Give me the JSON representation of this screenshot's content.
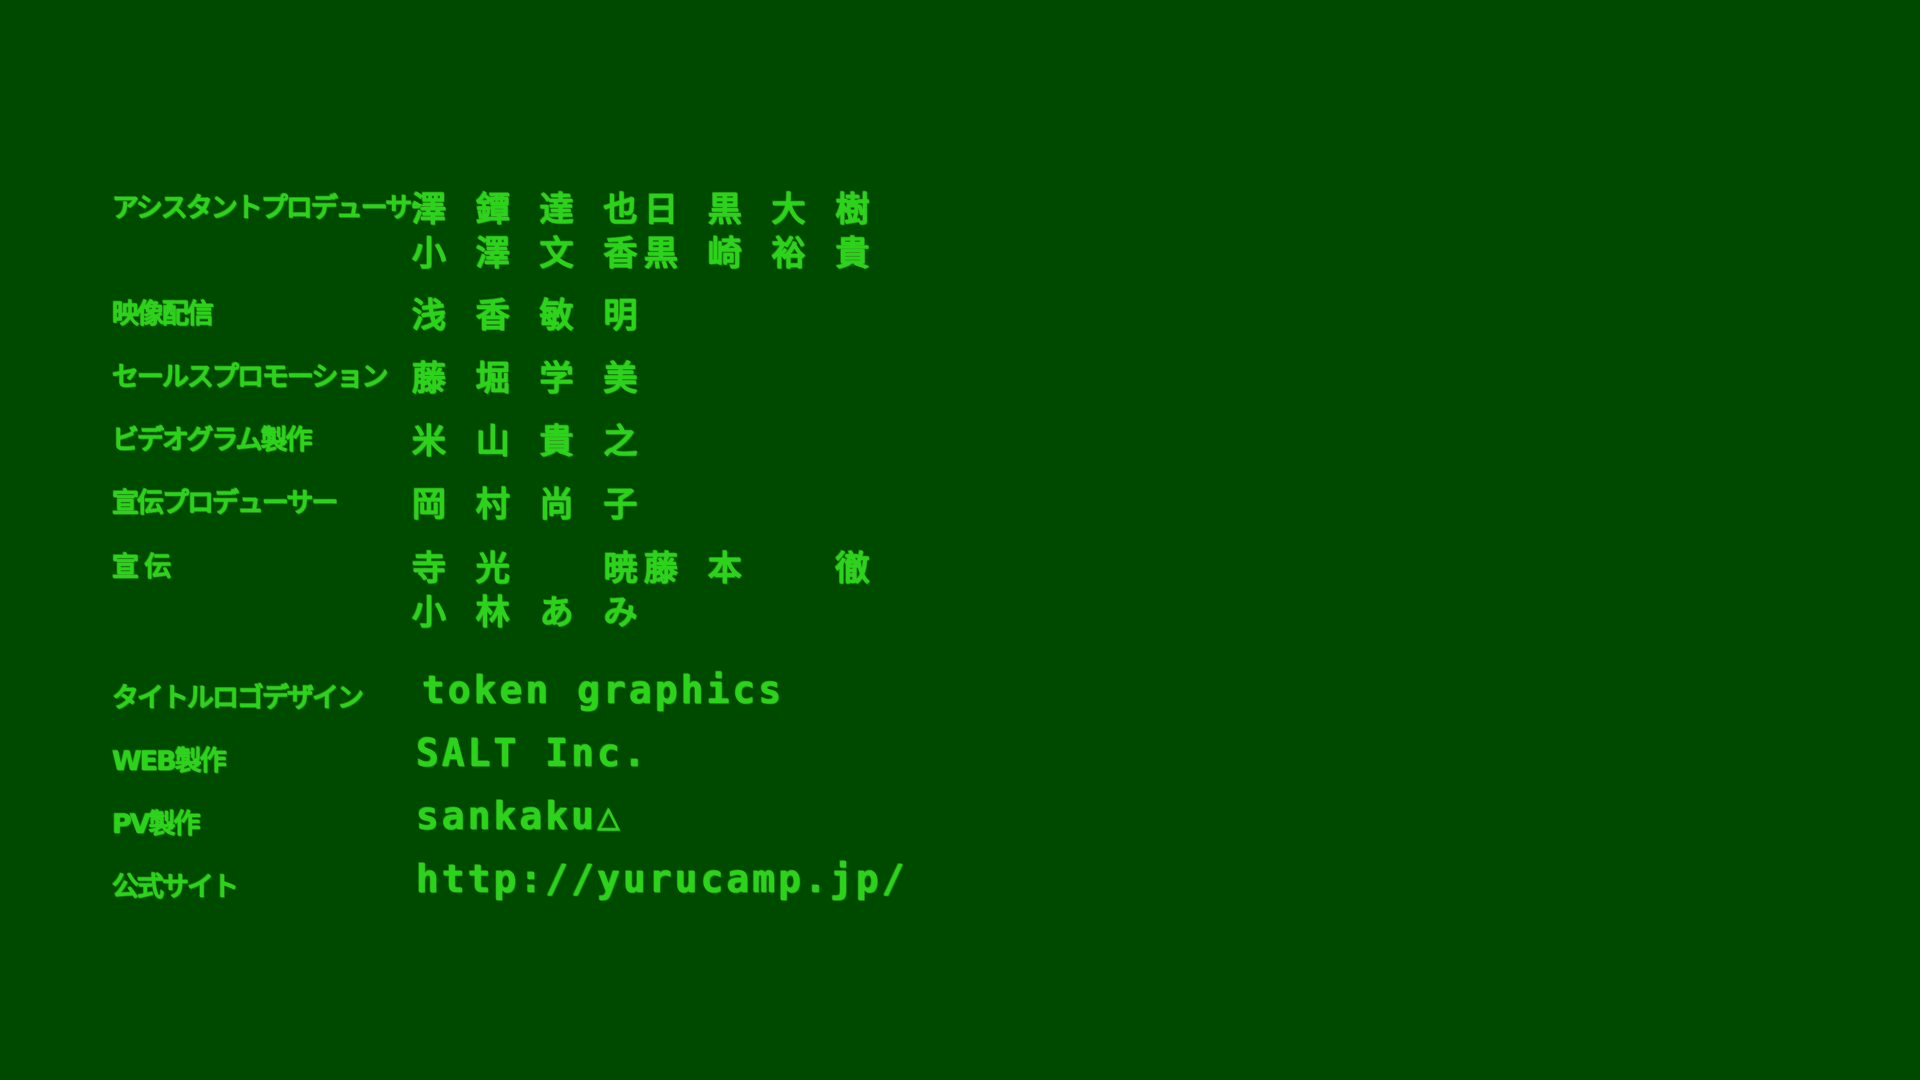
{
  "colors": {
    "background": "#004a00",
    "text": "#2bd41a"
  },
  "credits": [
    {
      "role": "アシスタントプロデューサー",
      "names": [
        "澤 鐔 達 也",
        "日 黒 大 樹",
        "小 澤 文 香",
        "黒 崎 裕 貴"
      ]
    },
    {
      "role": "映像配信",
      "names": [
        "浅 香 敏 明"
      ]
    },
    {
      "role": "セールスプロモーション",
      "names": [
        "藤 堀 学 美"
      ]
    },
    {
      "role": "ビデオグラム製作",
      "names": [
        "米 山 貴 之"
      ]
    },
    {
      "role": "宣伝プロデューサー",
      "names": [
        "岡 村 尚 子"
      ]
    },
    {
      "role": "宣 伝",
      "names": [
        "寺 光 　 暁",
        "藤 本 　 徹",
        "小 林 あ み"
      ]
    },
    {
      "role": "タイトルロゴデザイン",
      "value": "token graphics"
    },
    {
      "role": "WEB製作",
      "value": "SALT Inc."
    },
    {
      "role": "PV製作",
      "value": "sankaku△"
    },
    {
      "role": "公式サイト",
      "value": "http://yurucamp.jp/"
    }
  ]
}
